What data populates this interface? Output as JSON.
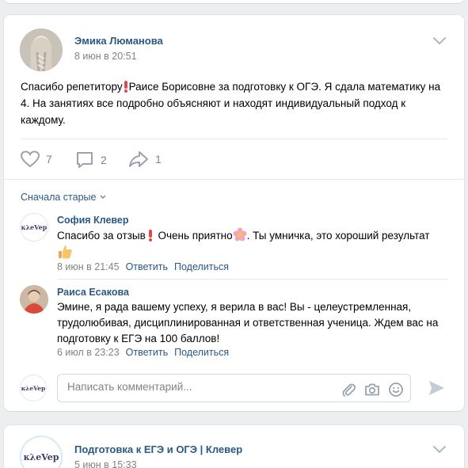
{
  "post": {
    "author": "Эмика Люманова",
    "date": "8 июн в 20:51",
    "text_part1": "Спасибо репетитору",
    "text_part2": "Раисе Борисовне за подготовку к ОГЭ. Я сдала математику на 4. На занятиях все подробно объясняют и находят индивидуальный подход к каждому.",
    "likes": "7",
    "comments": "2",
    "shares": "1"
  },
  "comments_section": {
    "sort_label": "Сначала старые",
    "items": [
      {
        "author": "София Клевер",
        "text_part1": "Спасибо за отзыв",
        "text_part2": " Очень приятно",
        "text_part3": ". Ты умничка, это хороший результат",
        "date": "8 июн в 21:45",
        "reply": "Ответить",
        "share": "Поделиться"
      },
      {
        "author": "Раиса Есакова",
        "text": "Эмине, я рада вашему успеху, я верила в вас! Вы - целеустремленная, трудолюбивая, дисциплинированная и ответственная ученица. Ждем вас на подготовку к ЕГЭ на 100 баллов!",
        "date": "6 июл в 23:23",
        "reply": "Ответить",
        "share": "Поделиться"
      }
    ],
    "input_placeholder": "Написать комментарий..."
  },
  "next_post": {
    "author": "Подготовка к ЕГЭ и ОГЭ | Клевер",
    "date": "5 июн в 15:33"
  },
  "logo_text": "кλeVeр",
  "colors": {
    "link": "#2a5885",
    "muted": "#828282",
    "background": "#edeef0",
    "icon": "#99a2ad",
    "accent": "#e64646"
  }
}
